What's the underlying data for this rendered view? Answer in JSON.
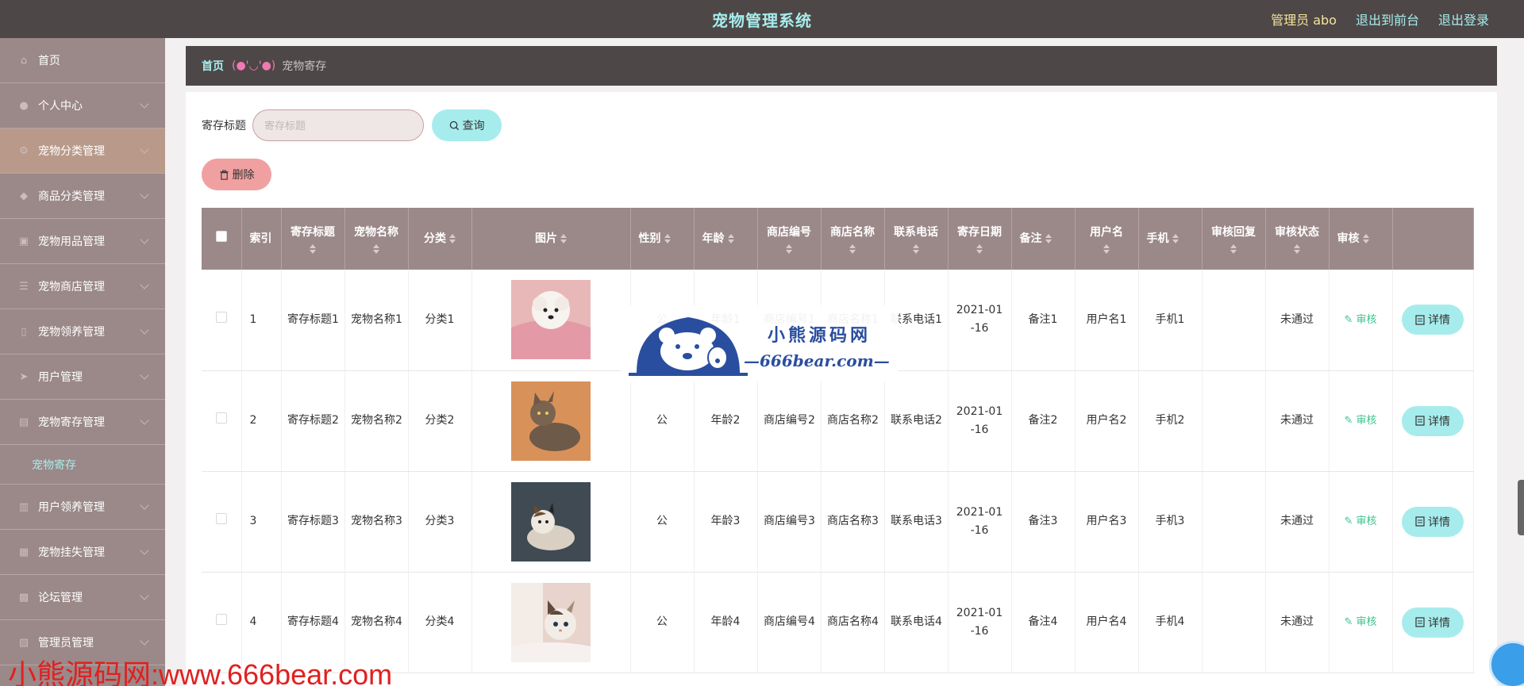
{
  "header": {
    "title": "宠物管理系统",
    "admin": "管理员 abo",
    "to_front": "退出到前台",
    "logout": "退出登录"
  },
  "sidebar": {
    "items": [
      {
        "label": "首页",
        "icon": "home-icon"
      },
      {
        "label": "个人中心",
        "icon": "user-icon"
      },
      {
        "label": "宠物分类管理",
        "icon": "gear-icon"
      },
      {
        "label": "商品分类管理",
        "icon": "tag-icon"
      },
      {
        "label": "宠物用品管理",
        "icon": "box-icon"
      },
      {
        "label": "宠物商店管理",
        "icon": "list-icon"
      },
      {
        "label": "宠物领养管理",
        "icon": "phone-icon"
      },
      {
        "label": "用户管理",
        "icon": "send-icon"
      },
      {
        "label": "宠物寄存管理",
        "icon": "document-icon"
      },
      {
        "label": "用户领养管理",
        "icon": "chart-icon"
      },
      {
        "label": "宠物挂失管理",
        "icon": "picture-icon"
      },
      {
        "label": "论坛管理",
        "icon": "grid-icon"
      },
      {
        "label": "管理员管理",
        "icon": "shop-icon"
      }
    ],
    "active_index": 2,
    "sub_item": "宠物寄存"
  },
  "breadcrumb": {
    "home": "首页",
    "face": "(●'◡'●)",
    "current": "宠物寄存"
  },
  "search": {
    "label": "寄存标题",
    "placeholder": "寄存标题",
    "button": "查询"
  },
  "toolbar": {
    "delete": "删除"
  },
  "table": {
    "headers": [
      "索引",
      "寄存标题",
      "宠物名称",
      "分类",
      "图片",
      "性别",
      "年龄",
      "商店编号",
      "商店名称",
      "联系电话",
      "寄存日期",
      "备注",
      "用户名",
      "手机",
      "审核回复",
      "审核状态",
      "审核"
    ],
    "rows": [
      {
        "index": "1",
        "title": "寄存标题1",
        "pet": "宠物名称1",
        "cat": "分类1",
        "sex": "公",
        "age": "年龄1",
        "shop_no": "商店编号1",
        "shop": "商店名称1",
        "tel": "联系电话1",
        "date": "2021-01-16",
        "note": "备注1",
        "user": "用户名1",
        "phone": "手机1",
        "reply": "",
        "status": "未通过",
        "audit": "审核",
        "detail": "详情",
        "img": "white-dog"
      },
      {
        "index": "2",
        "title": "寄存标题2",
        "pet": "宠物名称2",
        "cat": "分类2",
        "sex": "公",
        "age": "年龄2",
        "shop_no": "商店编号2",
        "shop": "商店名称2",
        "tel": "联系电话2",
        "date": "2021-01-16",
        "note": "备注2",
        "user": "用户名2",
        "phone": "手机2",
        "reply": "",
        "status": "未通过",
        "audit": "审核",
        "detail": "详情",
        "img": "tabby-cat"
      },
      {
        "index": "3",
        "title": "寄存标题3",
        "pet": "宠物名称3",
        "cat": "分类3",
        "sex": "公",
        "age": "年龄3",
        "shop_no": "商店编号3",
        "shop": "商店名称3",
        "tel": "联系电话3",
        "date": "2021-01-16",
        "note": "备注3",
        "user": "用户名3",
        "phone": "手机3",
        "reply": "",
        "status": "未通过",
        "audit": "审核",
        "detail": "详情",
        "img": "calico-cat"
      },
      {
        "index": "4",
        "title": "寄存标题4",
        "pet": "宠物名称4",
        "cat": "分类4",
        "sex": "公",
        "age": "年龄4",
        "shop_no": "商店编号4",
        "shop": "商店名称4",
        "tel": "联系电话4",
        "date": "2021-01-16",
        "note": "备注4",
        "user": "用户名4",
        "phone": "手机4",
        "reply": "",
        "status": "未通过",
        "audit": "审核",
        "detail": "详情",
        "img": "kitten"
      }
    ]
  },
  "watermark": {
    "text": "小熊源码网:www.666bear.com",
    "logo_cn": "小熊源码网",
    "logo_en": "—666bear.com—"
  },
  "colors": {
    "topbar": "#4e4747",
    "sidebar": "#9b8888",
    "accent": "#a7ecec",
    "delete": "#f0a0a0",
    "audit": "#3cc48e"
  }
}
